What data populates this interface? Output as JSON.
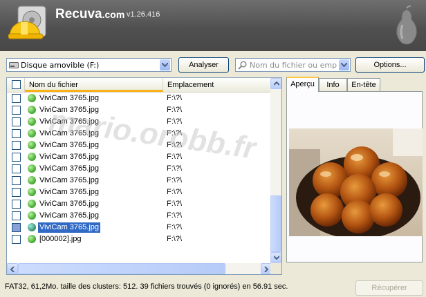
{
  "app": {
    "name": "Recuva",
    "suffix": ".com",
    "version": "v1.26.416"
  },
  "toolbar": {
    "drive_select": "Disque amovible (F:)",
    "analyze_label": "Analyser",
    "search_placeholder": "Nom du fichier ou emplacement",
    "options_label": "Options..."
  },
  "columns": {
    "name": "Nom du fichier",
    "location": "Emplacement"
  },
  "files": [
    {
      "name": "ViviCam 3765.jpg",
      "location": "F:\\?\\",
      "status": "green"
    },
    {
      "name": "ViviCam 3765.jpg",
      "location": "F:\\?\\",
      "status": "green"
    },
    {
      "name": "ViviCam 3765.jpg",
      "location": "F:\\?\\",
      "status": "green"
    },
    {
      "name": "ViviCam 3765.jpg",
      "location": "F:\\?\\",
      "status": "green"
    },
    {
      "name": "ViviCam 3765.jpg",
      "location": "F:\\?\\",
      "status": "green"
    },
    {
      "name": "ViviCam 3765.jpg",
      "location": "F:\\?\\",
      "status": "green"
    },
    {
      "name": "ViviCam 3765.jpg",
      "location": "F:\\?\\",
      "status": "green"
    },
    {
      "name": "ViviCam 3765.jpg",
      "location": "F:\\?\\",
      "status": "green"
    },
    {
      "name": "ViviCam 3765.jpg",
      "location": "F:\\?\\",
      "status": "green"
    },
    {
      "name": "ViviCam 3765.jpg",
      "location": "F:\\?\\",
      "status": "green"
    },
    {
      "name": "ViviCam 3765.jpg",
      "location": "F:\\?\\",
      "status": "green"
    },
    {
      "name": "ViviCam 3765.jpg",
      "location": "F:\\?\\",
      "status": "green",
      "selected": true
    },
    {
      "name": "[000002].jpg",
      "location": "F:\\?\\",
      "status": "green"
    }
  ],
  "tabs": [
    "Aperçu",
    "Info",
    "En-tête"
  ],
  "active_tab": "Aperçu",
  "status_text": "FAT32, 61,2Mo. taille des clusters: 512. 39 fichiers trouvés (0 ignorés) en 56.91 sec.",
  "recover_label": "Récupérer",
  "watermark": "mario.orobb.fr",
  "colors": {
    "header": "#505050",
    "selection": "#316ac5",
    "sort_indicator": "#f9b119",
    "recoverable": "#3ea62a"
  }
}
